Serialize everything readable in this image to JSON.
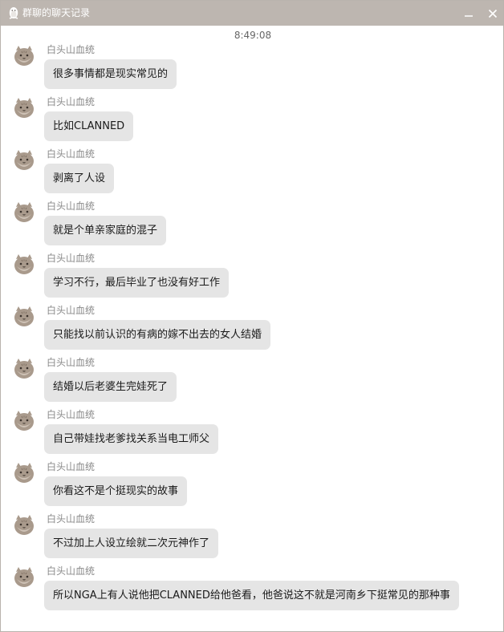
{
  "window": {
    "title": "群聊的聊天记录",
    "minimize_icon": "minimize-icon",
    "close_icon": "close-icon",
    "app_icon": "qq-penguin-icon",
    "titlebar_color": "#bdb6b0"
  },
  "chat": {
    "timestamp": "8:49:08",
    "bubble_color": "#e5e5e5",
    "messages": [
      {
        "sender": "白头山血统",
        "text": "很多事情都是现实常见的"
      },
      {
        "sender": "白头山血统",
        "text": "比如CLANNED"
      },
      {
        "sender": "白头山血统",
        "text": "剥离了人设"
      },
      {
        "sender": "白头山血统",
        "text": "就是个单亲家庭的混子"
      },
      {
        "sender": "白头山血统",
        "text": "学习不行，最后毕业了也没有好工作"
      },
      {
        "sender": "白头山血统",
        "text": "只能找以前认识的有病的嫁不出去的女人结婚"
      },
      {
        "sender": "白头山血统",
        "text": "结婚以后老婆生完娃死了"
      },
      {
        "sender": "白头山血统",
        "text": "自己带娃找老爹找关系当电工师父"
      },
      {
        "sender": "白头山血统",
        "text": "你看这不是个挺现实的故事"
      },
      {
        "sender": "白头山血统",
        "text": "不过加上人设立绘就二次元神作了"
      },
      {
        "sender": "白头山血统",
        "text": "所以NGA上有人说他把CLANNED给他爸看，他爸说这不就是河南乡下挺常见的那种事"
      }
    ]
  }
}
